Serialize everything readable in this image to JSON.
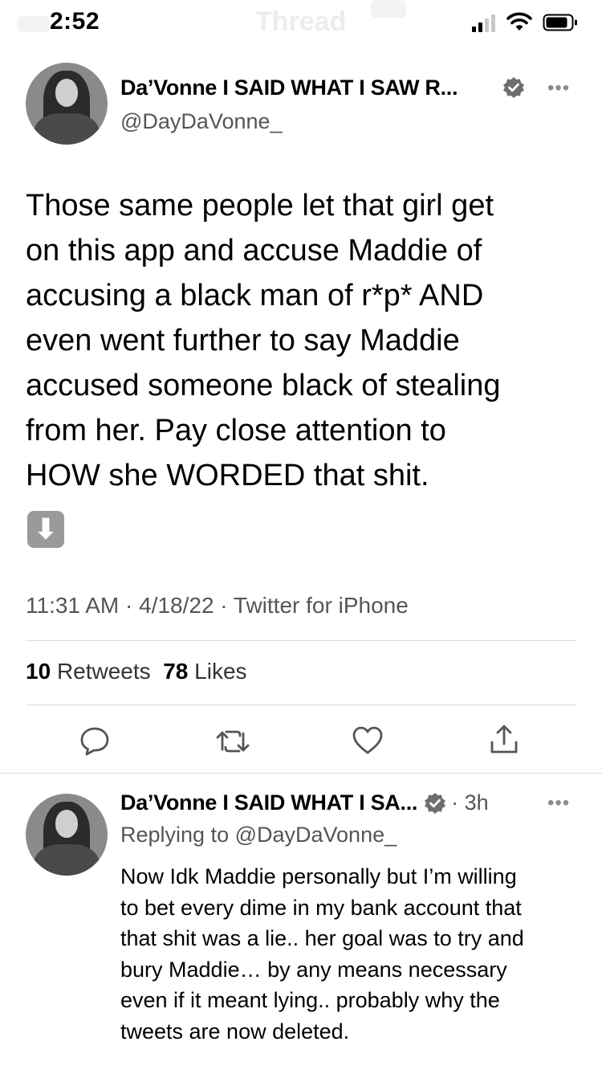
{
  "status_bar": {
    "time": "2:52",
    "faded_title": "Thread"
  },
  "main_tweet": {
    "author_name": "Da’Vonne I SAID WHAT I SAW R...",
    "handle": "@DayDaVonne_",
    "more": "•••",
    "text": [
      "Those same people let that girl get",
      "on this app and accuse Maddie of",
      "accusing a black man of r*p* AND",
      "even went further to say Maddie",
      "accused someone black of stealing",
      "from her. Pay close attention to",
      "HOW she WORDED that shit."
    ],
    "emoji": "⬇",
    "timestamp": "11:31 AM · 4/18/22 · Twitter for iPhone",
    "retweets_count": "10",
    "retweets_label": "Retweets",
    "likes_count": "78",
    "likes_label": "Likes"
  },
  "actions": [
    "reply-icon",
    "retweet-icon",
    "like-icon",
    "share-icon"
  ],
  "reply_tweet": {
    "author_name": "Da’Vonne I SAID WHAT I SA...",
    "time": "· 3h",
    "more": "•••",
    "replying_to": "Replying to @DayDaVonne_",
    "text": [
      "Now Idk Maddie personally but I’m willing",
      "to bet every dime in my bank account that",
      "that shit was a lie.. her goal was to try and",
      "bury Maddie… by any means necessary",
      "even if it meant lying.. probably why the",
      "tweets are now deleted."
    ]
  }
}
